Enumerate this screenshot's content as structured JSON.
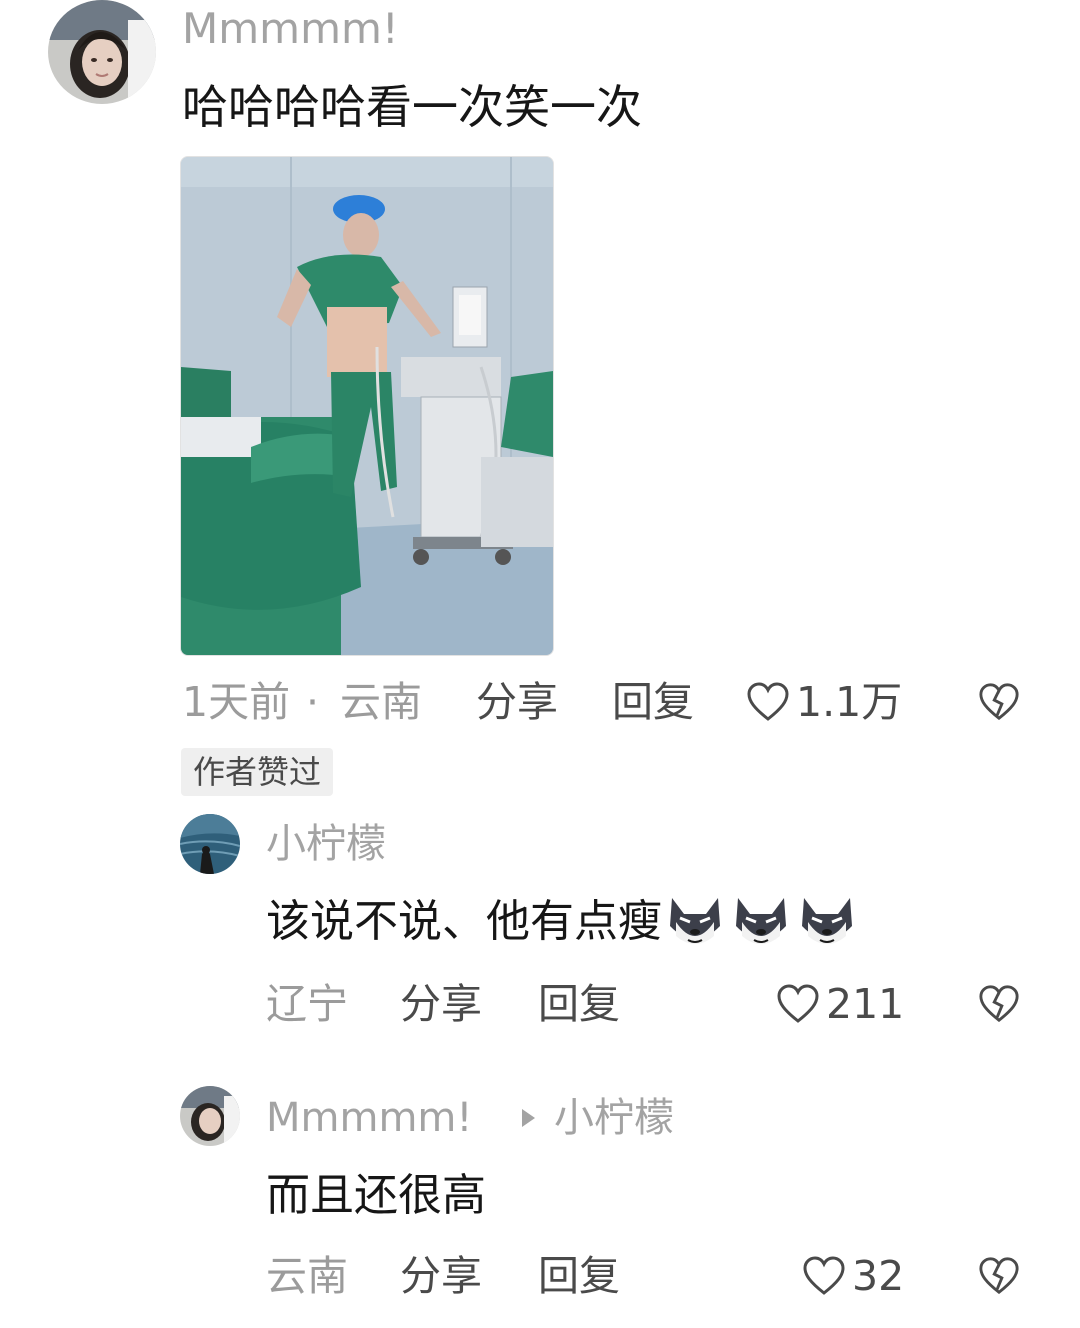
{
  "comments": [
    {
      "username": "Mmmmm!",
      "text": "哈哈哈哈看一次笑一次",
      "time": "1天前",
      "separator": "·",
      "location": "云南",
      "share_label": "分享",
      "reply_label": "回复",
      "likes": "1.1万",
      "badge": "作者赞过"
    },
    {
      "username": "小柠檬",
      "text": "该说不说、他有点瘦",
      "emoji_icons": [
        "husky-emoji-icon",
        "husky-emoji-icon",
        "husky-emoji-icon"
      ],
      "location": "辽宁",
      "share_label": "分享",
      "reply_label": "回复",
      "likes": "211"
    },
    {
      "username": "Mmmmm!",
      "reply_to": "小柠檬",
      "text": "而且还很高",
      "location": "云南",
      "share_label": "分享",
      "reply_label": "回复",
      "likes": "32"
    }
  ],
  "colors": {
    "scrub_green": "#2e8a6a",
    "wall_blue": "#b9c9d6",
    "cap_blue": "#2d7fd8"
  }
}
